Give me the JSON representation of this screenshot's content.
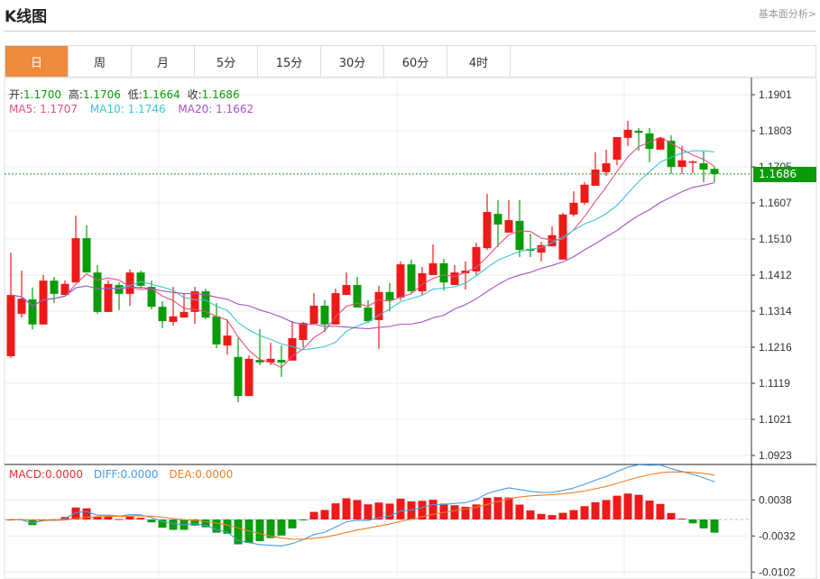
{
  "header": {
    "title": "K线图",
    "link": "基本面分析>"
  },
  "tabs": [
    {
      "label": "日",
      "active": true
    },
    {
      "label": "周"
    },
    {
      "label": "月"
    },
    {
      "label": "5分"
    },
    {
      "label": "15分"
    },
    {
      "label": "30分"
    },
    {
      "label": "60分"
    },
    {
      "label": "4时"
    }
  ],
  "info": {
    "open_label": "开:",
    "open": "1.1700",
    "high_label": "高:",
    "high": "1.1706",
    "low_label": "低:",
    "low": "1.1664",
    "close_label": "收:",
    "close": "1.1686",
    "ma5_label": "MA5: ",
    "ma5": "1.1707",
    "ma10_label": "MA10: ",
    "ma10": "1.1746",
    "ma20_label": "MA20: ",
    "ma20": "1.1662"
  },
  "macd_info": {
    "macd_label": "MACD:",
    "macd": "0.0000",
    "diff_label": "DIFF:",
    "diff": "0.0000",
    "dea_label": "DEA:",
    "dea": "0.0000"
  },
  "last_price": "1.1686",
  "colors": {
    "up": "#ee1a1a",
    "down": "#0a9c0a",
    "ma5": "#e4507f",
    "ma10": "#3ec6d0",
    "ma20": "#a453c0",
    "diff": "#4a9ae0",
    "dea": "#f07d22",
    "accent": "#f08a3c"
  },
  "chart_data": {
    "type": "candlestick",
    "price_ticks": [
      "1.1901",
      "1.1803",
      "1.1705",
      "1.1607",
      "1.1510",
      "1.1412",
      "1.1314",
      "1.1216",
      "1.1119",
      "1.1021",
      "1.0923"
    ],
    "ylim": [
      1.0923,
      1.1901
    ],
    "macd_ticks": [
      "0.0038",
      "-0.0032",
      "-0.0102"
    ],
    "grid": true,
    "ohlc": [
      [
        1.1192,
        1.1473,
        1.1187,
        1.1358
      ],
      [
        1.1307,
        1.1424,
        1.1297,
        1.1348
      ],
      [
        1.1346,
        1.1378,
        1.1265,
        1.1278
      ],
      [
        1.1278,
        1.1412,
        1.1278,
        1.1397
      ],
      [
        1.1397,
        1.1407,
        1.1336,
        1.1361
      ],
      [
        1.1358,
        1.1397,
        1.1358,
        1.1388
      ],
      [
        1.1392,
        1.1573,
        1.1392,
        1.1512
      ],
      [
        1.1512,
        1.1547,
        1.1419,
        1.1419
      ],
      [
        1.1419,
        1.1439,
        1.1307,
        1.1312
      ],
      [
        1.1312,
        1.1397,
        1.1312,
        1.1388
      ],
      [
        1.1385,
        1.1392,
        1.1317,
        1.1361
      ],
      [
        1.1361,
        1.1427,
        1.1329,
        1.1419
      ],
      [
        1.1419,
        1.1424,
        1.1375,
        1.1383
      ],
      [
        1.138,
        1.1397,
        1.1319,
        1.1326
      ],
      [
        1.1326,
        1.1341,
        1.1268,
        1.1287
      ],
      [
        1.1285,
        1.138,
        1.1275,
        1.13
      ],
      [
        1.1297,
        1.1363,
        1.1297,
        1.1312
      ],
      [
        1.1312,
        1.138,
        1.128,
        1.1368
      ],
      [
        1.1368,
        1.1375,
        1.1292,
        1.1297
      ],
      [
        1.13,
        1.1336,
        1.1214,
        1.1224
      ],
      [
        1.1221,
        1.1292,
        1.1197,
        1.1248
      ],
      [
        1.119,
        1.1241,
        1.1067,
        1.1084
      ],
      [
        1.1084,
        1.1194,
        1.1084,
        1.1185
      ],
      [
        1.1182,
        1.1265,
        1.1168,
        1.1175
      ],
      [
        1.1175,
        1.1229,
        1.1168,
        1.1185
      ],
      [
        1.1182,
        1.1221,
        1.1136,
        1.1175
      ],
      [
        1.118,
        1.1287,
        1.118,
        1.1241
      ],
      [
        1.1236,
        1.1285,
        1.1216,
        1.1282
      ],
      [
        1.128,
        1.1363,
        1.128,
        1.1329
      ],
      [
        1.1329,
        1.1344,
        1.1258,
        1.1278
      ],
      [
        1.1278,
        1.1375,
        1.1278,
        1.1363
      ],
      [
        1.1358,
        1.1419,
        1.1358,
        1.1385
      ],
      [
        1.1385,
        1.1407,
        1.1324,
        1.1324
      ],
      [
        1.1324,
        1.1344,
        1.1282,
        1.1287
      ],
      [
        1.129,
        1.1383,
        1.1212,
        1.1366
      ],
      [
        1.1366,
        1.139,
        1.1314,
        1.1344
      ],
      [
        1.1351,
        1.1449,
        1.1344,
        1.1441
      ],
      [
        1.1441,
        1.1454,
        1.1363,
        1.1368
      ],
      [
        1.1368,
        1.1434,
        1.1358,
        1.1417
      ],
      [
        1.1412,
        1.1495,
        1.1412,
        1.1444
      ],
      [
        1.1444,
        1.1456,
        1.137,
        1.1392
      ],
      [
        1.1385,
        1.1439,
        1.1385,
        1.1419
      ],
      [
        1.1417,
        1.1449,
        1.1373,
        1.1424
      ],
      [
        1.1422,
        1.15,
        1.141,
        1.1488
      ],
      [
        1.1485,
        1.1632,
        1.148,
        1.1583
      ],
      [
        1.1578,
        1.1615,
        1.1488,
        1.1549
      ],
      [
        1.1527,
        1.1615,
        1.1527,
        1.1561
      ],
      [
        1.1559,
        1.1615,
        1.1461,
        1.148
      ],
      [
        1.1483,
        1.1524,
        1.1461,
        1.1478
      ],
      [
        1.1473,
        1.1502,
        1.1449,
        1.1493
      ],
      [
        1.149,
        1.1544,
        1.149,
        1.152
      ],
      [
        1.1454,
        1.1581,
        1.1454,
        1.1576
      ],
      [
        1.1576,
        1.1639,
        1.1571,
        1.1608
      ],
      [
        1.1608,
        1.1664,
        1.1603,
        1.1657
      ],
      [
        1.1654,
        1.1745,
        1.1654,
        1.1698
      ],
      [
        1.1691,
        1.1752,
        1.1681,
        1.1715
      ],
      [
        1.1725,
        1.1786,
        1.171,
        1.1786
      ],
      [
        1.1784,
        1.183,
        1.1762,
        1.1806
      ],
      [
        1.1803,
        1.1811,
        1.1749,
        1.1798
      ],
      [
        1.1796,
        1.1811,
        1.1718,
        1.1754
      ],
      [
        1.1752,
        1.1786,
        1.1752,
        1.1784
      ],
      [
        1.1776,
        1.1791,
        1.1686,
        1.1705
      ],
      [
        1.1705,
        1.1762,
        1.1686,
        1.1723
      ],
      [
        1.1718,
        1.1723,
        1.1688,
        1.172
      ],
      [
        1.1715,
        1.1747,
        1.1664,
        1.1698
      ],
      [
        1.17,
        1.1706,
        1.1664,
        1.1686
      ]
    ]
  }
}
